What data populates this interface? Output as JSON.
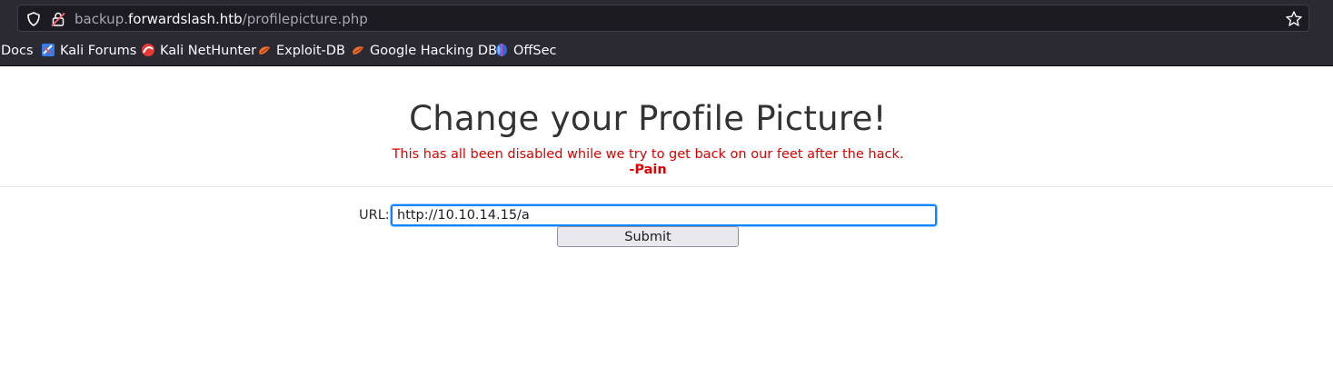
{
  "browser": {
    "url_prefix": "backup.",
    "url_host": "forwardslash.htb",
    "url_path": "/profilepicture.php",
    "bookmarks": [
      {
        "label": "Docs",
        "icon": "none"
      },
      {
        "label": "Kali Forums",
        "icon": "kali-forums-icon"
      },
      {
        "label": "Kali NetHunter",
        "icon": "kali-nethunter-icon"
      },
      {
        "label": "Exploit-DB",
        "icon": "exploit-db-icon"
      },
      {
        "label": "Google Hacking DB",
        "icon": "ghdb-icon"
      },
      {
        "label": "OffSec",
        "icon": "offsec-icon"
      }
    ]
  },
  "page": {
    "title": "Change your Profile Picture!",
    "notice": "This has all been disabled while we try to get back on our feet after the hack.",
    "signature": "-Pain",
    "form": {
      "url_label": "URL:",
      "url_value": "http://10.10.14.15/a",
      "submit_label": "Submit"
    }
  },
  "colors": {
    "notice": "#dd0000",
    "title": "#333333",
    "focus_ring": "#0a84ff",
    "chrome_bg": "#2b2a33"
  }
}
